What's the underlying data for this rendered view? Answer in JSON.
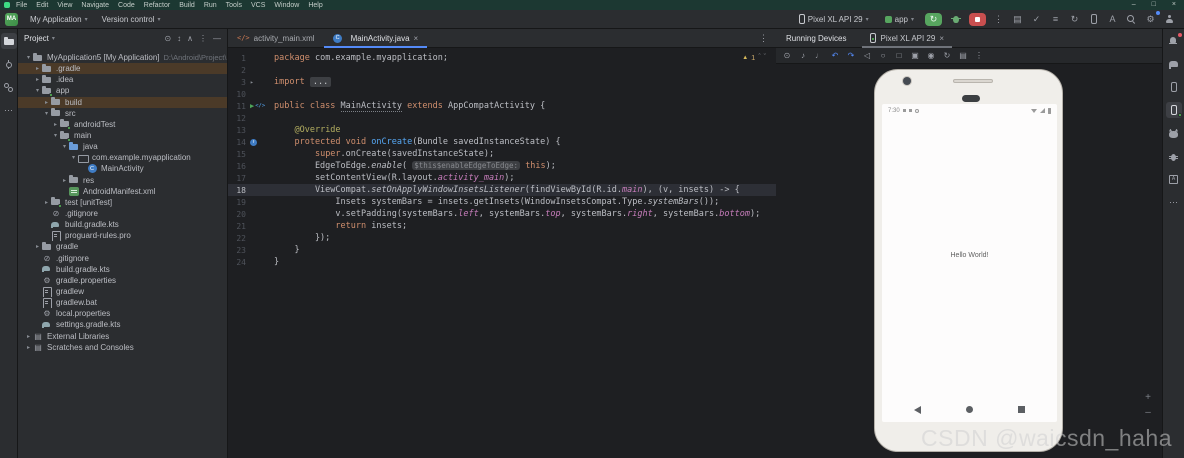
{
  "titlebar": {
    "menus": [
      "File",
      "Edit",
      "View",
      "Navigate",
      "Code",
      "Refactor",
      "Build",
      "Run",
      "Tools",
      "VCS",
      "Window",
      "Help"
    ],
    "window_controls": [
      {
        "name": "minimize",
        "glyph": "–"
      },
      {
        "name": "maximize",
        "glyph": "□"
      },
      {
        "name": "close",
        "glyph": "×"
      }
    ]
  },
  "toolbar": {
    "project_badge": "MA",
    "project_name": "My Application",
    "vcs_label": "Version control",
    "device_selector": "Pixel XL API 29",
    "run_config": "app",
    "run_label": "run",
    "stop_label": "stop",
    "right_icons": [
      {
        "name": "todo",
        "glyph": "▤"
      },
      {
        "name": "code-inspection",
        "glyph": "✓"
      },
      {
        "name": "build-variants",
        "glyph": "≡"
      },
      {
        "name": "gradle-sync",
        "glyph": "↻"
      },
      {
        "name": "device-manager",
        "css": "i-phone"
      },
      {
        "name": "translate",
        "glyph": "A"
      },
      {
        "name": "search",
        "css": "i-search"
      },
      {
        "name": "settings",
        "glyph": "⚙",
        "badge": "blue"
      },
      {
        "name": "profile",
        "css": "i-profile"
      }
    ]
  },
  "left_strip": [
    {
      "name": "project",
      "css": "i-folder",
      "active": true
    },
    {
      "name": "commit",
      "css": "i-commit"
    },
    {
      "name": "pull-requests",
      "css": "i-pr"
    },
    {
      "name": "more",
      "glyph": "⋯"
    }
  ],
  "right_strip": [
    {
      "name": "notifications",
      "css": "i-bell",
      "badge": "red"
    },
    {
      "name": "gradle",
      "css": "i-gradle"
    },
    {
      "name": "device-manager",
      "css": "i-phone"
    },
    {
      "name": "running-devices",
      "css": "i-phone",
      "active": true,
      "badge": "green"
    },
    {
      "name": "logcat",
      "css": "i-logcat"
    },
    {
      "name": "app-quality-insights",
      "css": "i-bug"
    },
    {
      "name": "device-explorer",
      "css": "i-explorer",
      "letter": "A"
    },
    {
      "name": "more",
      "glyph": "⋯"
    }
  ],
  "project_panel": {
    "title": "Project",
    "header_icons": [
      {
        "name": "locate-file",
        "glyph": "⊙"
      },
      {
        "name": "expand-all",
        "glyph": "↕"
      },
      {
        "name": "collapse-all",
        "glyph": "∧"
      },
      {
        "name": "options",
        "glyph": "⋮"
      },
      {
        "name": "hide",
        "glyph": "—"
      }
    ],
    "tree": [
      {
        "indent": 0,
        "chev": "open",
        "icon": "folder",
        "label": "MyApplication5 [My Application]",
        "extra": "D:\\Android\\Project\\MyApplicati"
      },
      {
        "indent": 1,
        "chev": "closed",
        "icon": "folder",
        "label": ".gradle",
        "hl": true
      },
      {
        "indent": 1,
        "chev": "closed",
        "icon": "folder",
        "label": ".idea"
      },
      {
        "indent": 1,
        "chev": "open",
        "icon": "folder-green",
        "label": "app"
      },
      {
        "indent": 2,
        "chev": "closed",
        "icon": "folder",
        "label": "build",
        "hl": true
      },
      {
        "indent": 2,
        "chev": "open",
        "icon": "folder",
        "label": "src"
      },
      {
        "indent": 3,
        "chev": "closed",
        "icon": "folder-green",
        "label": "androidTest"
      },
      {
        "indent": 3,
        "chev": "open",
        "icon": "folder-green",
        "label": "main"
      },
      {
        "indent": 4,
        "chev": "open",
        "icon": "folder-blue",
        "label": "java"
      },
      {
        "indent": 5,
        "chev": "open",
        "icon": "package",
        "label": "com.example.myapplication"
      },
      {
        "indent": 6,
        "chev": "none",
        "icon": "class",
        "label": "MainActivity"
      },
      {
        "indent": 4,
        "chev": "closed",
        "icon": "folder",
        "label": "res"
      },
      {
        "indent": 4,
        "chev": "none",
        "icon": "xml",
        "label": "AndroidManifest.xml"
      },
      {
        "indent": 2,
        "chev": "closed",
        "icon": "folder-green",
        "label": "test [unitTest]"
      },
      {
        "indent": 2,
        "chev": "none",
        "icon": "ignore",
        "label": ".gitignore"
      },
      {
        "indent": 2,
        "chev": "none",
        "icon": "gradle",
        "label": "build.gradle.kts"
      },
      {
        "indent": 2,
        "chev": "none",
        "icon": "text",
        "label": "proguard-rules.pro"
      },
      {
        "indent": 1,
        "chev": "closed",
        "icon": "folder",
        "label": "gradle"
      },
      {
        "indent": 1,
        "chev": "none",
        "icon": "ignore",
        "label": ".gitignore"
      },
      {
        "indent": 1,
        "chev": "none",
        "icon": "gradle",
        "label": "build.gradle.kts"
      },
      {
        "indent": 1,
        "chev": "none",
        "icon": "gear",
        "label": "gradle.properties"
      },
      {
        "indent": 1,
        "chev": "none",
        "icon": "text",
        "label": "gradlew"
      },
      {
        "indent": 1,
        "chev": "none",
        "icon": "text",
        "label": "gradlew.bat"
      },
      {
        "indent": 1,
        "chev": "none",
        "icon": "gear",
        "label": "local.properties"
      },
      {
        "indent": 1,
        "chev": "none",
        "icon": "gradle",
        "label": "settings.gradle.kts"
      },
      {
        "indent": 0,
        "chev": "closed",
        "icon": "lib",
        "label": "External Libraries"
      },
      {
        "indent": 0,
        "chev": "closed",
        "icon": "lib",
        "label": "Scratches and Consoles"
      }
    ]
  },
  "editor": {
    "tabs": [
      {
        "label": "activity_main.xml",
        "icon": "xml",
        "active": false
      },
      {
        "label": "MainActivity.java",
        "icon": "class",
        "active": true,
        "closable": true
      }
    ],
    "more_glyph": "⋮",
    "warnings": {
      "count": "1"
    },
    "code": [
      {
        "n": "1",
        "segs": [
          [
            "k",
            "package "
          ],
          [
            "d",
            "com.example.myapplication;"
          ]
        ]
      },
      {
        "n": "2",
        "segs": []
      },
      {
        "n": "3",
        "fold": true,
        "segs": [
          [
            "k",
            "import "
          ],
          [
            "fold",
            "..."
          ]
        ]
      },
      {
        "n": "10",
        "segs": []
      },
      {
        "n": "11",
        "run": true,
        "segs": [
          [
            "k",
            "public class "
          ],
          [
            "decl",
            "MainActivity"
          ],
          [
            "k",
            " extends "
          ],
          [
            "d",
            "AppCompatActivity {"
          ]
        ]
      },
      {
        "n": "12",
        "segs": []
      },
      {
        "n": "13",
        "segs": [
          [
            "d",
            "    "
          ],
          [
            "a",
            "@Override"
          ]
        ]
      },
      {
        "n": "14",
        "ovr": true,
        "segs": [
          [
            "d",
            "    "
          ],
          [
            "k",
            "protected void "
          ],
          [
            "m",
            "onCreate"
          ],
          [
            "d",
            "(Bundle savedInstanceState) {"
          ]
        ]
      },
      {
        "n": "15",
        "segs": [
          [
            "d",
            "        "
          ],
          [
            "k",
            "super"
          ],
          [
            "d",
            ".onCreate(savedInstanceState);"
          ]
        ]
      },
      {
        "n": "16",
        "segs": [
          [
            "d",
            "        EdgeToEdge."
          ],
          [
            "it",
            "enable"
          ],
          [
            "d",
            "( "
          ],
          [
            "chip",
            "$this$enableEdgeToEdge:"
          ],
          [
            "d",
            " "
          ],
          [
            "k",
            "this"
          ],
          [
            "d",
            ");"
          ]
        ]
      },
      {
        "n": "17",
        "segs": [
          [
            "d",
            "        setContentView(R.layout."
          ],
          [
            "f",
            "activity_main"
          ],
          [
            "d",
            ");"
          ]
        ]
      },
      {
        "n": "18",
        "current": true,
        "segs": [
          [
            "d",
            "        ViewCompat."
          ],
          [
            "it",
            "setOnApplyWindowInsetsListener"
          ],
          [
            "d",
            "(findViewById(R.id."
          ],
          [
            "f",
            "main"
          ],
          [
            "d",
            "), (v, insets) -> {"
          ]
        ]
      },
      {
        "n": "19",
        "segs": [
          [
            "d",
            "            Insets systemBars = insets.getInsets(WindowInsetsCompat.Type."
          ],
          [
            "it",
            "systemBars"
          ],
          [
            "d",
            "());"
          ]
        ]
      },
      {
        "n": "20",
        "segs": [
          [
            "d",
            "            v.setPadding(systemBars."
          ],
          [
            "f",
            "left"
          ],
          [
            "d",
            ", systemBars."
          ],
          [
            "f",
            "top"
          ],
          [
            "d",
            ", systemBars."
          ],
          [
            "f",
            "right"
          ],
          [
            "d",
            ", systemBars."
          ],
          [
            "f",
            "bottom"
          ],
          [
            "d",
            ");"
          ]
        ]
      },
      {
        "n": "21",
        "segs": [
          [
            "d",
            "            "
          ],
          [
            "k",
            "return "
          ],
          [
            "d",
            "insets;"
          ]
        ]
      },
      {
        "n": "22",
        "segs": [
          [
            "d",
            "        });"
          ]
        ]
      },
      {
        "n": "23",
        "segs": [
          [
            "d",
            "    }"
          ]
        ]
      },
      {
        "n": "24",
        "segs": [
          [
            "d",
            "}"
          ]
        ]
      }
    ]
  },
  "devices_panel": {
    "title": "Running Devices",
    "tab": {
      "label": "Pixel XL API 29",
      "close": "×"
    },
    "toolbar": [
      {
        "name": "power",
        "glyph": "⊙"
      },
      {
        "name": "volume-up",
        "glyph": "♪"
      },
      {
        "name": "volume-down",
        "glyph": "♩"
      },
      {
        "name": "rotate-left",
        "glyph": "↶",
        "accent": true
      },
      {
        "name": "rotate-right",
        "glyph": "↷",
        "accent": true
      },
      {
        "name": "back",
        "glyph": "◁"
      },
      {
        "name": "home",
        "glyph": "○"
      },
      {
        "name": "overview",
        "glyph": "□"
      },
      {
        "name": "screenshot",
        "glyph": "▣"
      },
      {
        "name": "screen-record",
        "glyph": "◉"
      },
      {
        "name": "restart",
        "glyph": "↻"
      },
      {
        "name": "snapshots",
        "glyph": "▤"
      },
      {
        "name": "more",
        "glyph": "⋮"
      }
    ],
    "phone": {
      "time": "7:30",
      "message": "Hello World!"
    },
    "zoom_controls": [
      {
        "name": "zoom-in",
        "glyph": "+"
      },
      {
        "name": "zoom-out",
        "glyph": "–"
      }
    ]
  },
  "colors": {
    "accent_blue": "#548af7",
    "run_green": "#57a55f",
    "stop_red": "#c94f4f",
    "titlebar_green": "#1c3832",
    "tree_highlight": "#4b3a28"
  },
  "watermark": "CSDN @waicsdn_haha"
}
